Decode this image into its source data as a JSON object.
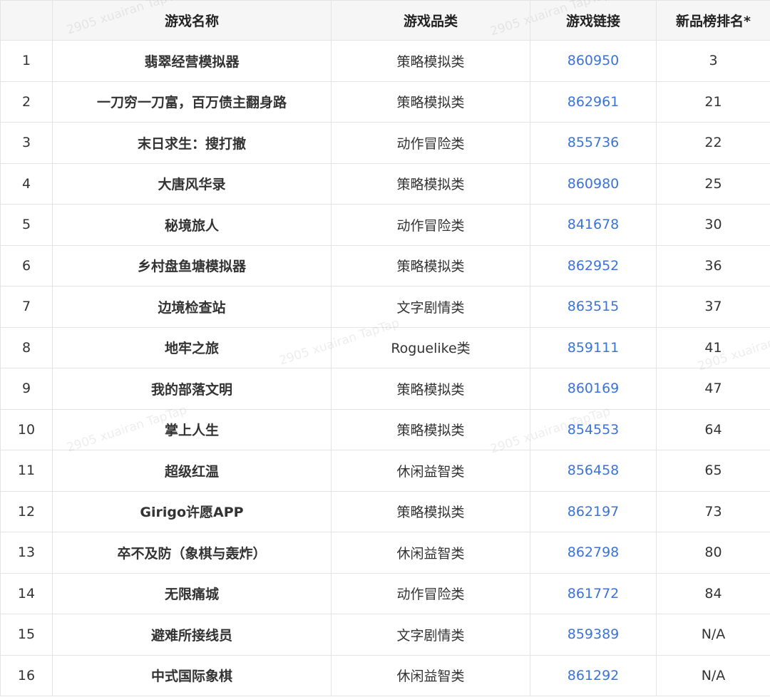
{
  "table": {
    "headers": {
      "index": "",
      "name": "游戏名称",
      "category": "游戏品类",
      "link": "游戏链接",
      "rank": "新品榜排名*"
    },
    "rows": [
      {
        "index": "1",
        "name": "翡翠经营模拟器",
        "category": "策略模拟类",
        "link": "860950",
        "rank": "3"
      },
      {
        "index": "2",
        "name": "一刀穷一刀富，百万债主翻身路",
        "category": "策略模拟类",
        "link": "862961",
        "rank": "21"
      },
      {
        "index": "3",
        "name": "末日求生：搜打撤",
        "category": "动作冒险类",
        "link": "855736",
        "rank": "22"
      },
      {
        "index": "4",
        "name": "大唐风华录",
        "category": "策略模拟类",
        "link": "860980",
        "rank": "25"
      },
      {
        "index": "5",
        "name": "秘境旅人",
        "category": "动作冒险类",
        "link": "841678",
        "rank": "30"
      },
      {
        "index": "6",
        "name": "乡村盘鱼塘模拟器",
        "category": "策略模拟类",
        "link": "862952",
        "rank": "36"
      },
      {
        "index": "7",
        "name": "边境检查站",
        "category": "文字剧情类",
        "link": "863515",
        "rank": "37"
      },
      {
        "index": "8",
        "name": "地牢之旅",
        "category": "Roguelike类",
        "link": "859111",
        "rank": "41"
      },
      {
        "index": "9",
        "name": "我的部落文明",
        "category": "策略模拟类",
        "link": "860169",
        "rank": "47"
      },
      {
        "index": "10",
        "name": "掌上人生",
        "category": "策略模拟类",
        "link": "854553",
        "rank": "64"
      },
      {
        "index": "11",
        "name": "超级红温",
        "category": "休闲益智类",
        "link": "856458",
        "rank": "65"
      },
      {
        "index": "12",
        "name": "Girigo许愿APP",
        "category": "策略模拟类",
        "link": "862197",
        "rank": "73"
      },
      {
        "index": "13",
        "name": "卒不及防（象棋与轰炸）",
        "category": "休闲益智类",
        "link": "862798",
        "rank": "80"
      },
      {
        "index": "14",
        "name": "无限痛城",
        "category": "动作冒险类",
        "link": "861772",
        "rank": "84"
      },
      {
        "index": "15",
        "name": "避难所接线员",
        "category": "文字剧情类",
        "link": "859389",
        "rank": "N/A"
      },
      {
        "index": "16",
        "name": "中式国际象棋",
        "category": "休闲益智类",
        "link": "861292",
        "rank": "N/A"
      }
    ]
  },
  "watermark": "2905 xuairan TapTap",
  "colors": {
    "link": "#3b73d6",
    "header_bg": "#f6f6f6",
    "border": "#e4e4e4",
    "text": "#222222"
  }
}
